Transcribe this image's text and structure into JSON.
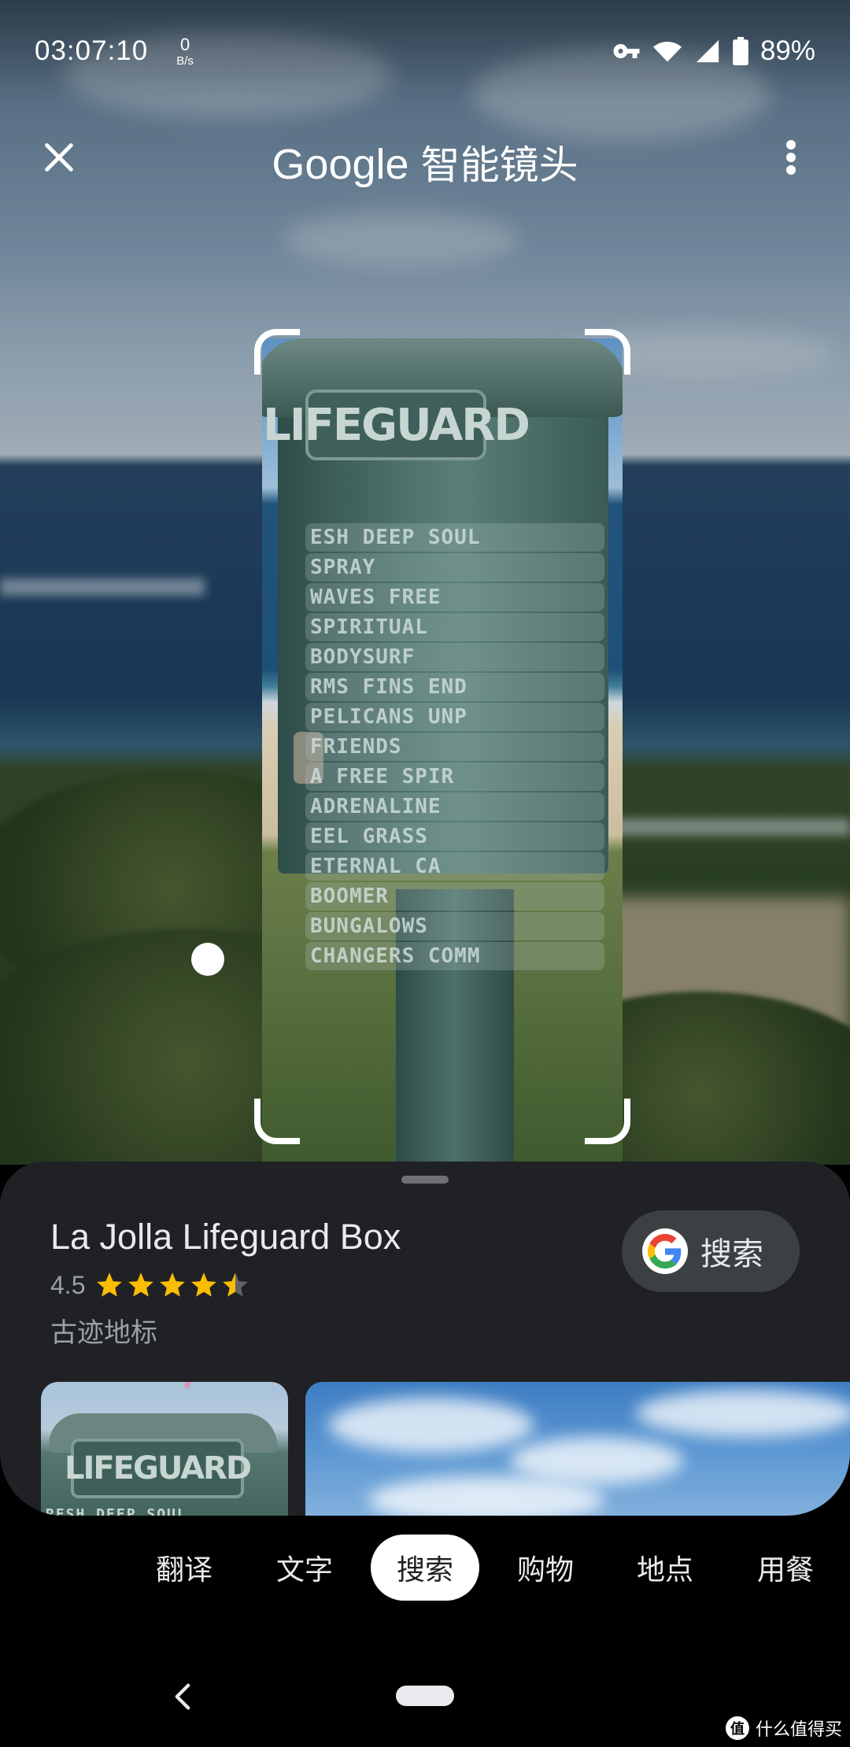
{
  "status_bar": {
    "time": "03:07:10",
    "net_speed_value": "0",
    "net_speed_unit": "B/s",
    "battery_percent": "89%",
    "icons": [
      "vpn-key-icon",
      "wifi-icon",
      "cell-signal-icon",
      "battery-icon"
    ]
  },
  "app_bar": {
    "brand": "Google",
    "title": "智能镜头",
    "close_icon": "close-icon",
    "menu_icon": "more-vert-icon"
  },
  "viewfinder": {
    "plaque_text": "LIFEGUARD",
    "box_words": [
      "ESH DEEP SOUL",
      "SPRAY",
      "WAVES FREE",
      "SPIRITUAL",
      "BODYSURF",
      "RMS FINS END",
      "PELICANS UNP",
      "FRIENDS",
      "A FREE SPIR",
      "ADRENALINE",
      "EEL GRASS",
      "ETERNAL CA",
      "BOOMER",
      "BUNGALOWS",
      "CHANGERS COMM"
    ]
  },
  "result": {
    "place_name": "La Jolla Lifeguard Box",
    "rating": "4.5",
    "rating_value": 4.5,
    "rating_max": 5,
    "category": "古迹地标",
    "search_button_label": "搜索",
    "thumb1_plaque": "LIFEGUARD",
    "thumb1_subtext": "RESH DEEP SOUL"
  },
  "modes": {
    "items": [
      "翻译",
      "文字",
      "搜索",
      "购物",
      "地点",
      "用餐"
    ],
    "active": "搜索"
  },
  "nav_bar": {
    "back_icon": "back-chevron-icon",
    "home_icon": "home-pill-icon"
  },
  "watermark": {
    "badge": "值",
    "text": "什么值得买"
  },
  "colors": {
    "sheet_bg": "#202124",
    "chip_bg": "#3c4043",
    "star": "#fbbc04",
    "google_blue": "#4285f4",
    "google_red": "#ea4335",
    "google_yellow": "#fbbc05",
    "google_green": "#34a853"
  }
}
